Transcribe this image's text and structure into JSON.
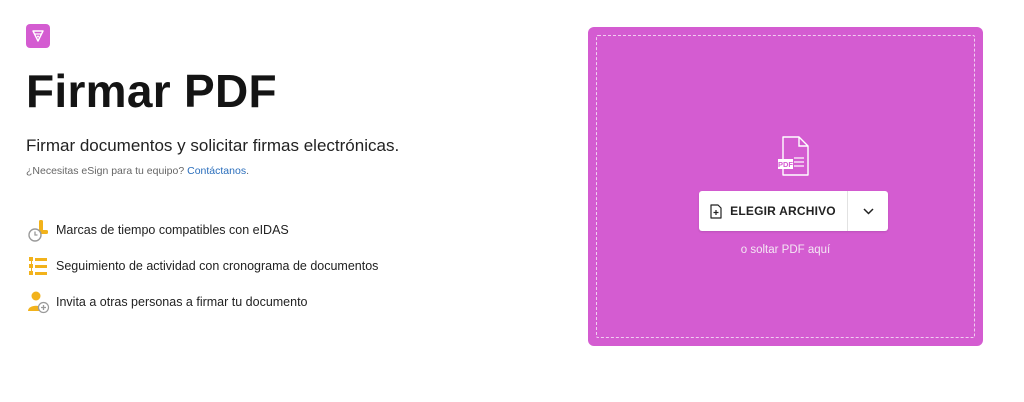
{
  "brand": {
    "logo_icon": "pen-nib-icon",
    "accent": "#d45cd1"
  },
  "header": {
    "title": "Firmar PDF",
    "subtitle": "Firmar documentos y solicitar firmas electrónicas.",
    "team_prompt": "¿Necesitas eSign para tu equipo?",
    "contact_link": "Contáctanos",
    "team_suffix": "."
  },
  "features": [
    {
      "icon": "timestamp-clock-icon",
      "label": "Marcas de tiempo compatibles con eIDAS"
    },
    {
      "icon": "activity-list-icon",
      "label": "Seguimiento de actividad con cronograma de documentos"
    },
    {
      "icon": "invite-user-icon",
      "label": "Invita a otras personas a firmar tu documento"
    }
  ],
  "upload": {
    "file_icon": "pdf-file-icon",
    "file_icon_text": "PDF",
    "choose_label": "ELEGIR ARCHIVO",
    "choose_icon": "add-file-icon",
    "dropdown_icon": "chevron-down-icon",
    "drop_hint": "o soltar PDF aquí"
  }
}
